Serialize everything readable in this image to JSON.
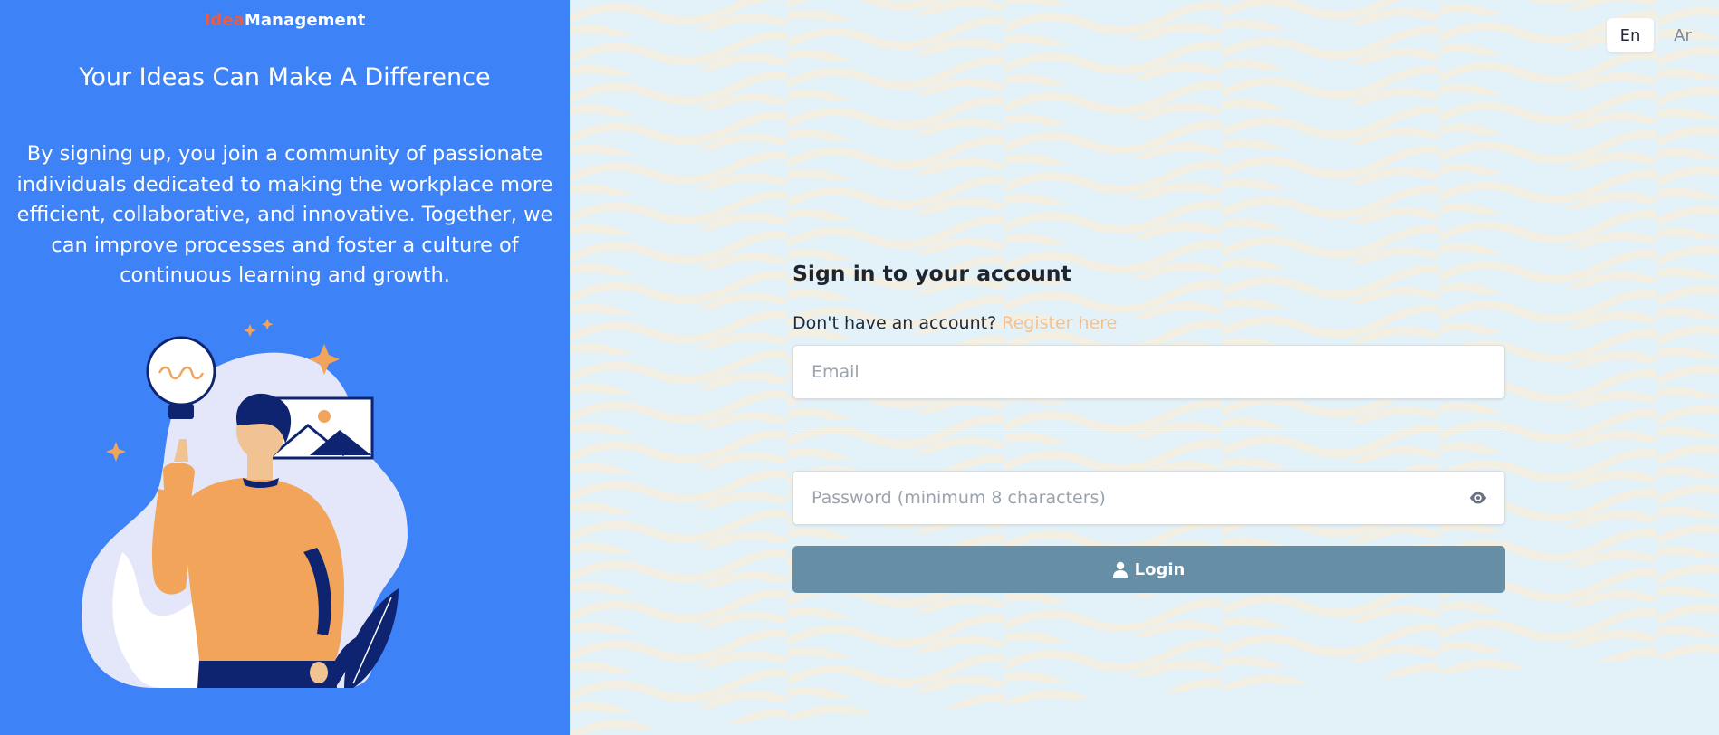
{
  "brand": {
    "part1": "Idea",
    "part2": "Management"
  },
  "hero": {
    "headline": "Your Ideas Can Make A Difference",
    "blurb": "By signing up, you join a community of passionate individuals dedicated to making the workplace more efficient, collaborative, and innovative. Together, we can improve processes and foster a culture of continuous learning and growth."
  },
  "language": {
    "options": [
      "En",
      "Ar"
    ],
    "selected": "En"
  },
  "form": {
    "title": "Sign in to your account",
    "signup_prompt": "Don't have an account?",
    "signup_link": "Register here",
    "email_placeholder": "Email",
    "password_placeholder": "Password (minimum 8 characters)",
    "login_label": "Login",
    "icons": {
      "password_toggle": "eye-icon",
      "login": "user-icon"
    }
  },
  "colors": {
    "left_panel": "#3d82f6",
    "brand_idea": "#f15a3a",
    "register_link": "#f6c08a",
    "login_button": "#668fa7",
    "right_background": "#e3f1f9"
  }
}
